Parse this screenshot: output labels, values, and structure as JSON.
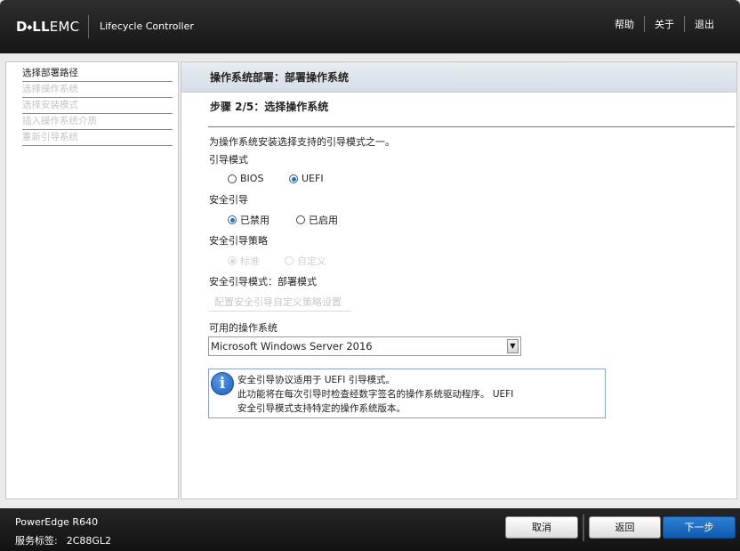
{
  "header": {
    "brand_bold": "D⬩LL",
    "brand_light": "EMC",
    "product": "Lifecycle Controller",
    "links": [
      "帮助",
      "关于",
      "退出"
    ]
  },
  "sidebar": {
    "items": [
      {
        "label": "选择部署路径",
        "active": true
      },
      {
        "label": "选择操作系统",
        "active": false
      },
      {
        "label": "选择安装模式",
        "active": false
      },
      {
        "label": "插入操作系统介质",
        "active": false
      },
      {
        "label": "重新引导系统",
        "active": false
      }
    ]
  },
  "main": {
    "title": "操作系统部署：部署操作系统",
    "step": "步骤 2/5：选择操作系统",
    "intro": "为操作系统安装选择支持的引导模式之一。",
    "boot_mode": {
      "label": "引导模式",
      "options": [
        "BIOS",
        "UEFI"
      ],
      "selected": "UEFI"
    },
    "secure_boot": {
      "label": "安全引导",
      "options": [
        "已禁用",
        "已启用"
      ],
      "selected": "已禁用"
    },
    "secure_policy": {
      "label": "安全引导策略",
      "options": [
        "标准",
        "自定义"
      ],
      "selected": "标准",
      "disabled": true
    },
    "secure_mode": "安全引导模式：部署模式",
    "config_link": "配置安全引导自定义策略设置",
    "os_label": "可用的操作系统",
    "os_selected": "Microsoft Windows Server 2016",
    "info_lines": [
      "安全引导协议适用于 UEFI 引导模式。",
      "此功能将在每次引导时检查经数字签名的操作系统驱动程序。 UEFI",
      "安全引导模式支持特定的操作系统版本。"
    ]
  },
  "footer": {
    "model": "PowerEdge R640",
    "service_tag_label": "服务标签:",
    "service_tag": "2C88GL2",
    "cancel": "取消",
    "back": "返回",
    "next": "下一步"
  }
}
